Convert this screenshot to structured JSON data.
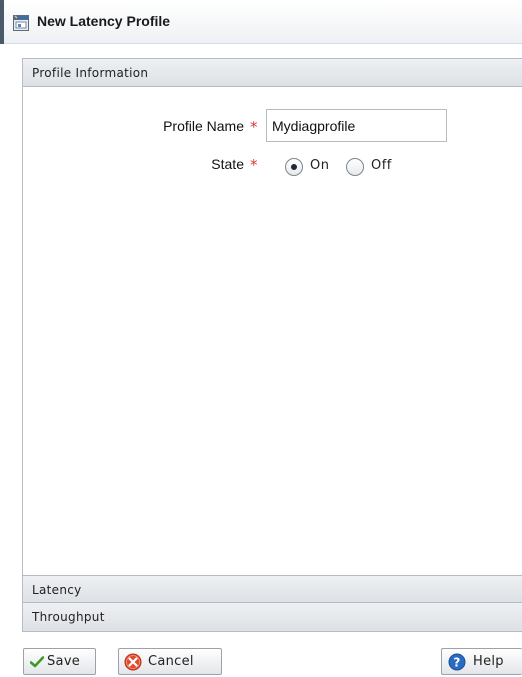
{
  "window": {
    "title": "New Latency Profile",
    "title_icon": "new-profile-window-icon"
  },
  "sections": {
    "profile_information": "Profile Information",
    "latency": "Latency",
    "throughput": "Throughput"
  },
  "form": {
    "profile_name_label": "Profile Name",
    "profile_name_value": "Mydiagprofile",
    "state_label": "State",
    "required_marker": "*",
    "state_options": [
      {
        "label": "On",
        "selected": true
      },
      {
        "label": "Off",
        "selected": false
      }
    ]
  },
  "buttons": {
    "save": {
      "label": "Save",
      "icon": "checkmark-icon"
    },
    "cancel": {
      "label": "Cancel",
      "icon": "cancel-icon"
    },
    "help": {
      "label": "Help",
      "icon": "help-icon"
    }
  },
  "colors": {
    "required": "#d83a3a",
    "save_check": "#3c9a2a",
    "cancel_icon": "#e04a2e",
    "help_icon": "#2a6bc2"
  }
}
